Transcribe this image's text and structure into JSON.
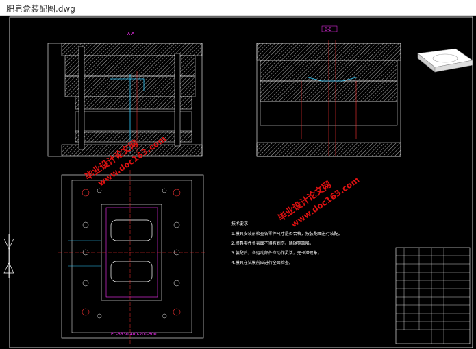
{
  "window": {
    "title": "肥皂盒装配图.dwg"
  },
  "drawing": {
    "section_a": "A-A",
    "section_b": "B-B",
    "notes_title": "技术要求：",
    "notes": [
      "1.模具安装前检查各零件尺寸是否合格，按装配图进行装配。",
      "2.模具零件各表面不得有划伤、磕碰等缺陷。",
      "3.装配后，各运动部件应动作灵活，无卡滞现象。",
      "4.模具在试模前应进行全面检查。"
    ],
    "bottom_label": "PC-BR30-400-200-500"
  },
  "watermarks": [
    {
      "text": "毕业设计论文网",
      "url": "www.doc163.com"
    },
    {
      "text": "毕业设计论文网",
      "url": "www.doc163.com"
    },
    {
      "text": "毕业设计论文网",
      "url": "www.doc163.com"
    }
  ],
  "colors": {
    "background": "#000000",
    "line": "#ffffff",
    "hatch": "#cccccc",
    "red": "#ff3333",
    "cyan": "#33ccff",
    "magenta": "#ff33ff",
    "watermark": "#dd1111"
  }
}
